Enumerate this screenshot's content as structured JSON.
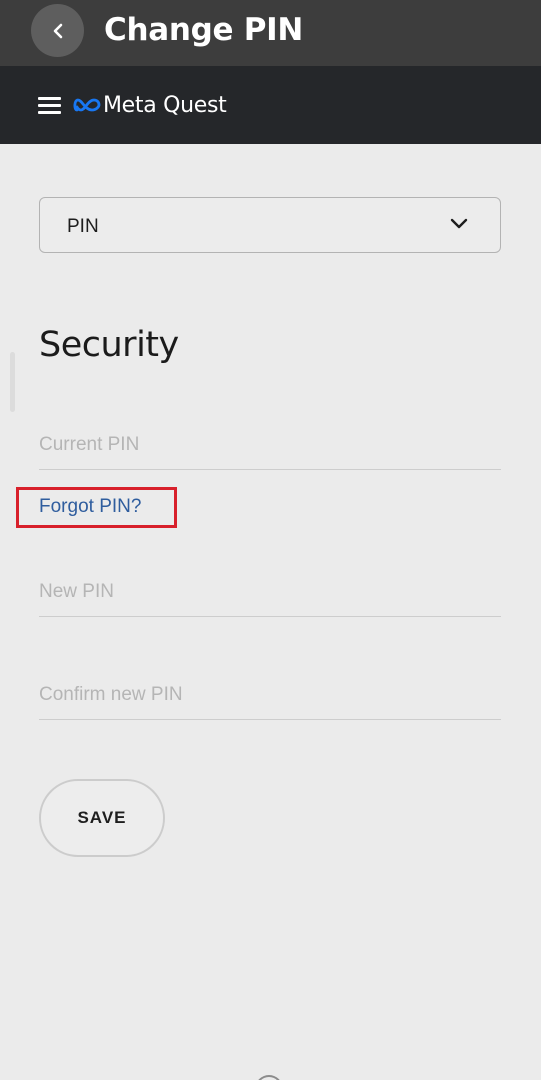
{
  "titlebar": {
    "back_icon": "chevron-left-icon",
    "title": "Change PIN"
  },
  "navbar": {
    "menu_icon": "hamburger-menu-icon",
    "brand_name": "Meta Quest",
    "brand_color": "#1877F2"
  },
  "selector": {
    "value": "PIN",
    "icon": "chevron-down-icon"
  },
  "security": {
    "title": "Security",
    "current_pin_placeholder": "Current PIN",
    "forgot_link": "Forgot PIN?",
    "new_pin_placeholder": "New PIN",
    "confirm_pin_placeholder": "Confirm new PIN",
    "save_label": "SAVE"
  },
  "colors": {
    "titlebar_bg": "#3d3d3d",
    "navbar_bg": "#25272a",
    "page_bg": "#ebebeb",
    "link": "#2f5d9e",
    "highlight_box": "#d8202b"
  }
}
